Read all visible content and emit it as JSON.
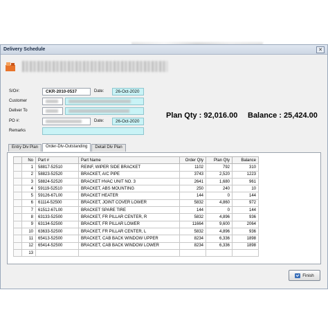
{
  "window": {
    "title": "Delivery Schedule",
    "close_glyph": "✕"
  },
  "form": {
    "so_label": "S/O#:",
    "so_value": "CKR-2010-0537",
    "date_label": "Date:",
    "date_value": "26-Oct-2020",
    "customer_label": "Customer",
    "deliver_to_label": "Deliver To",
    "po_label": "PO #:",
    "po_date_label": "Date:",
    "po_date_value": "26-Oct-2020",
    "remarks_label": "Remarks"
  },
  "summary": {
    "plan_qty": "Plan Qty : 92,016.00",
    "balance": "Balance : 25,424.00"
  },
  "tabs": [
    {
      "label": "Entry Dlv Plan",
      "active": false
    },
    {
      "label": "Order-Dlv-Outstanding",
      "active": true
    },
    {
      "label": "Detail Dlv Plan",
      "active": false
    }
  ],
  "grid": {
    "columns": [
      "No",
      "Part #",
      "Part Name",
      "Order Qty",
      "Plan Qty",
      "Balance"
    ],
    "rows": [
      [
        "1",
        "58817-52510",
        "REINF, WIPER SIDE BRACKET",
        "1102",
        "792",
        "310"
      ],
      [
        "2",
        "58823-52520",
        "BRACKET, A/C PIPE",
        "3743",
        "2,520",
        "1223"
      ],
      [
        "3",
        "58824-52520",
        "BRACKET HVAC UNIT NO. 3",
        "2641",
        "1,680",
        "961"
      ],
      [
        "4",
        "59119-52510",
        "BRACKET, ABS MOUNTING",
        "250",
        "240",
        "10"
      ],
      [
        "5",
        "59126-67L00",
        "BRACKET HEATER",
        "144",
        "0",
        "144"
      ],
      [
        "6",
        "61114-52500",
        "BRACKET, JOINT COVER LOWER",
        "5832",
        "4,860",
        "972"
      ],
      [
        "7",
        "61512-67L00",
        "BRACKET SPARE TIRE",
        "144",
        "0",
        "144"
      ],
      [
        "8",
        "63133-52500",
        "BRACKET, FR PILLAR CENTER, R",
        "5832",
        "4,896",
        "936"
      ],
      [
        "9",
        "63134-52500",
        "BRACKET, FR PILLAR LOWER",
        "11664",
        "9,600",
        "2064"
      ],
      [
        "10",
        "63633-52500",
        "BRACKET, FR PILLAR CENTER, L",
        "5832",
        "4,896",
        "936"
      ],
      [
        "11",
        "65413-52500",
        "BRACKET, CAB BACK WINDOW UPPER",
        "8234",
        "6,336",
        "1898"
      ],
      [
        "12",
        "65414-52500",
        "BRACKET, CAB BACK WINDOW LOWER",
        "8234",
        "6,336",
        "1898"
      ],
      [
        "13",
        "",
        "",
        "",
        "",
        ""
      ]
    ]
  },
  "finish_button": {
    "label": "Finish"
  }
}
